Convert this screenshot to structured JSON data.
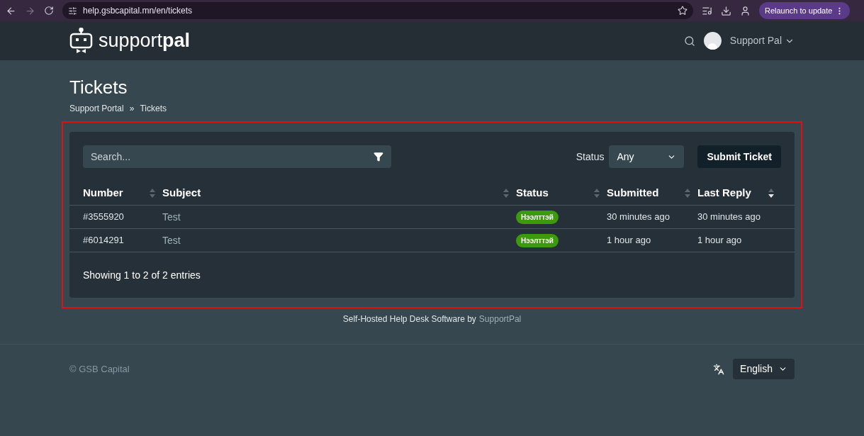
{
  "browser": {
    "url": "help.gsbcapital.mn/en/tickets",
    "relaunch": "Relaunch to update"
  },
  "header": {
    "logo": "support**pal**",
    "user": "Support Pal"
  },
  "page": {
    "title": "Tickets",
    "breadcrumbs": [
      "Support Portal",
      "»",
      "Tickets"
    ]
  },
  "toolbar": {
    "search_placeholder": "Search...",
    "status_label": "Status",
    "status_value": "Any",
    "submit": "Submit Ticket"
  },
  "table": {
    "columns": [
      {
        "label": "Number",
        "sorted": false
      },
      {
        "label": "Subject",
        "sorted": false
      },
      {
        "label": "Status",
        "sorted": false
      },
      {
        "label": "Submitted",
        "sorted": false
      },
      {
        "label": "Last Reply",
        "sorted": true
      }
    ],
    "rows": [
      {
        "number": "#3555920",
        "subject": "Test",
        "status": "Нээлттэй",
        "color": "#3c9a0c",
        "submitted": "30 minutes ago",
        "last_reply": "30 minutes ago"
      },
      {
        "number": "#6014291",
        "subject": "Test",
        "status": "Нээлттэй",
        "color": "#3c9a0c",
        "submitted": "1 hour ago",
        "last_reply": "1 hour ago"
      }
    ],
    "info": "Showing 1 to 2 of 2 entries"
  },
  "powered": {
    "text": "Self-Hosted Help Desk Software by",
    "link": "SupportPal"
  },
  "footer": {
    "copyright": "© GSB Capital",
    "language": "English"
  }
}
